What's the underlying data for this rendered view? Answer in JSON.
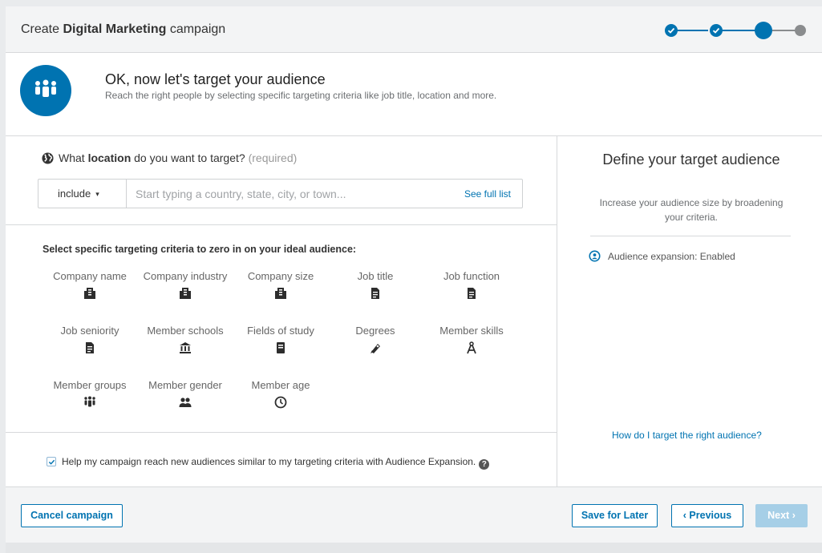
{
  "header": {
    "title_prefix": "Create ",
    "title_bold": "Digital Marketing",
    "title_suffix": " campaign",
    "steps": [
      "done",
      "done",
      "current",
      "todo"
    ]
  },
  "intro": {
    "icon": "audience-group-icon",
    "title": "OK, now let's target your audience",
    "subtitle": "Reach the right people by selecting specific targeting criteria like job title, location and more."
  },
  "location": {
    "question_prefix": "What ",
    "question_bold": "location",
    "question_suffix": " do you want to target?",
    "required": "(required)",
    "include_label": "include",
    "placeholder": "Start typing a country, state, city, or town...",
    "see_full_list": "See full list"
  },
  "criteria": {
    "heading": "Select specific targeting criteria to zero in on your ideal audience:",
    "items": [
      {
        "label": "Company name",
        "icon": "building-icon"
      },
      {
        "label": "Company industry",
        "icon": "building-icon"
      },
      {
        "label": "Company size",
        "icon": "building-icon"
      },
      {
        "label": "Job title",
        "icon": "document-icon"
      },
      {
        "label": "Job function",
        "icon": "document-icon"
      },
      {
        "label": "Job seniority",
        "icon": "document-icon"
      },
      {
        "label": "Member schools",
        "icon": "institution-icon"
      },
      {
        "label": "Fields of study",
        "icon": "book-icon"
      },
      {
        "label": "Degrees",
        "icon": "diploma-icon"
      },
      {
        "label": "Member skills",
        "icon": "compass-icon"
      },
      {
        "label": "Member groups",
        "icon": "group-icon"
      },
      {
        "label": "Member gender",
        "icon": "people-icon"
      },
      {
        "label": "Member age",
        "icon": "clock-icon"
      }
    ]
  },
  "expansion": {
    "checked": true,
    "label": "Help my campaign reach new audiences similar to my targeting criteria with Audience Expansion.",
    "help": "?"
  },
  "right_panel": {
    "title": "Define your target audience",
    "subtitle": "Increase your audience size by broadening your criteria.",
    "expansion_status": "Audience expansion: Enabled",
    "help_link": "How do I target the right audience?"
  },
  "footer": {
    "cancel": "Cancel campaign",
    "save": "Save for Later",
    "previous": "‹ Previous",
    "next": "Next ›"
  },
  "colors": {
    "accent": "#0073b1",
    "disabled_primary": "#a6cfe7"
  }
}
